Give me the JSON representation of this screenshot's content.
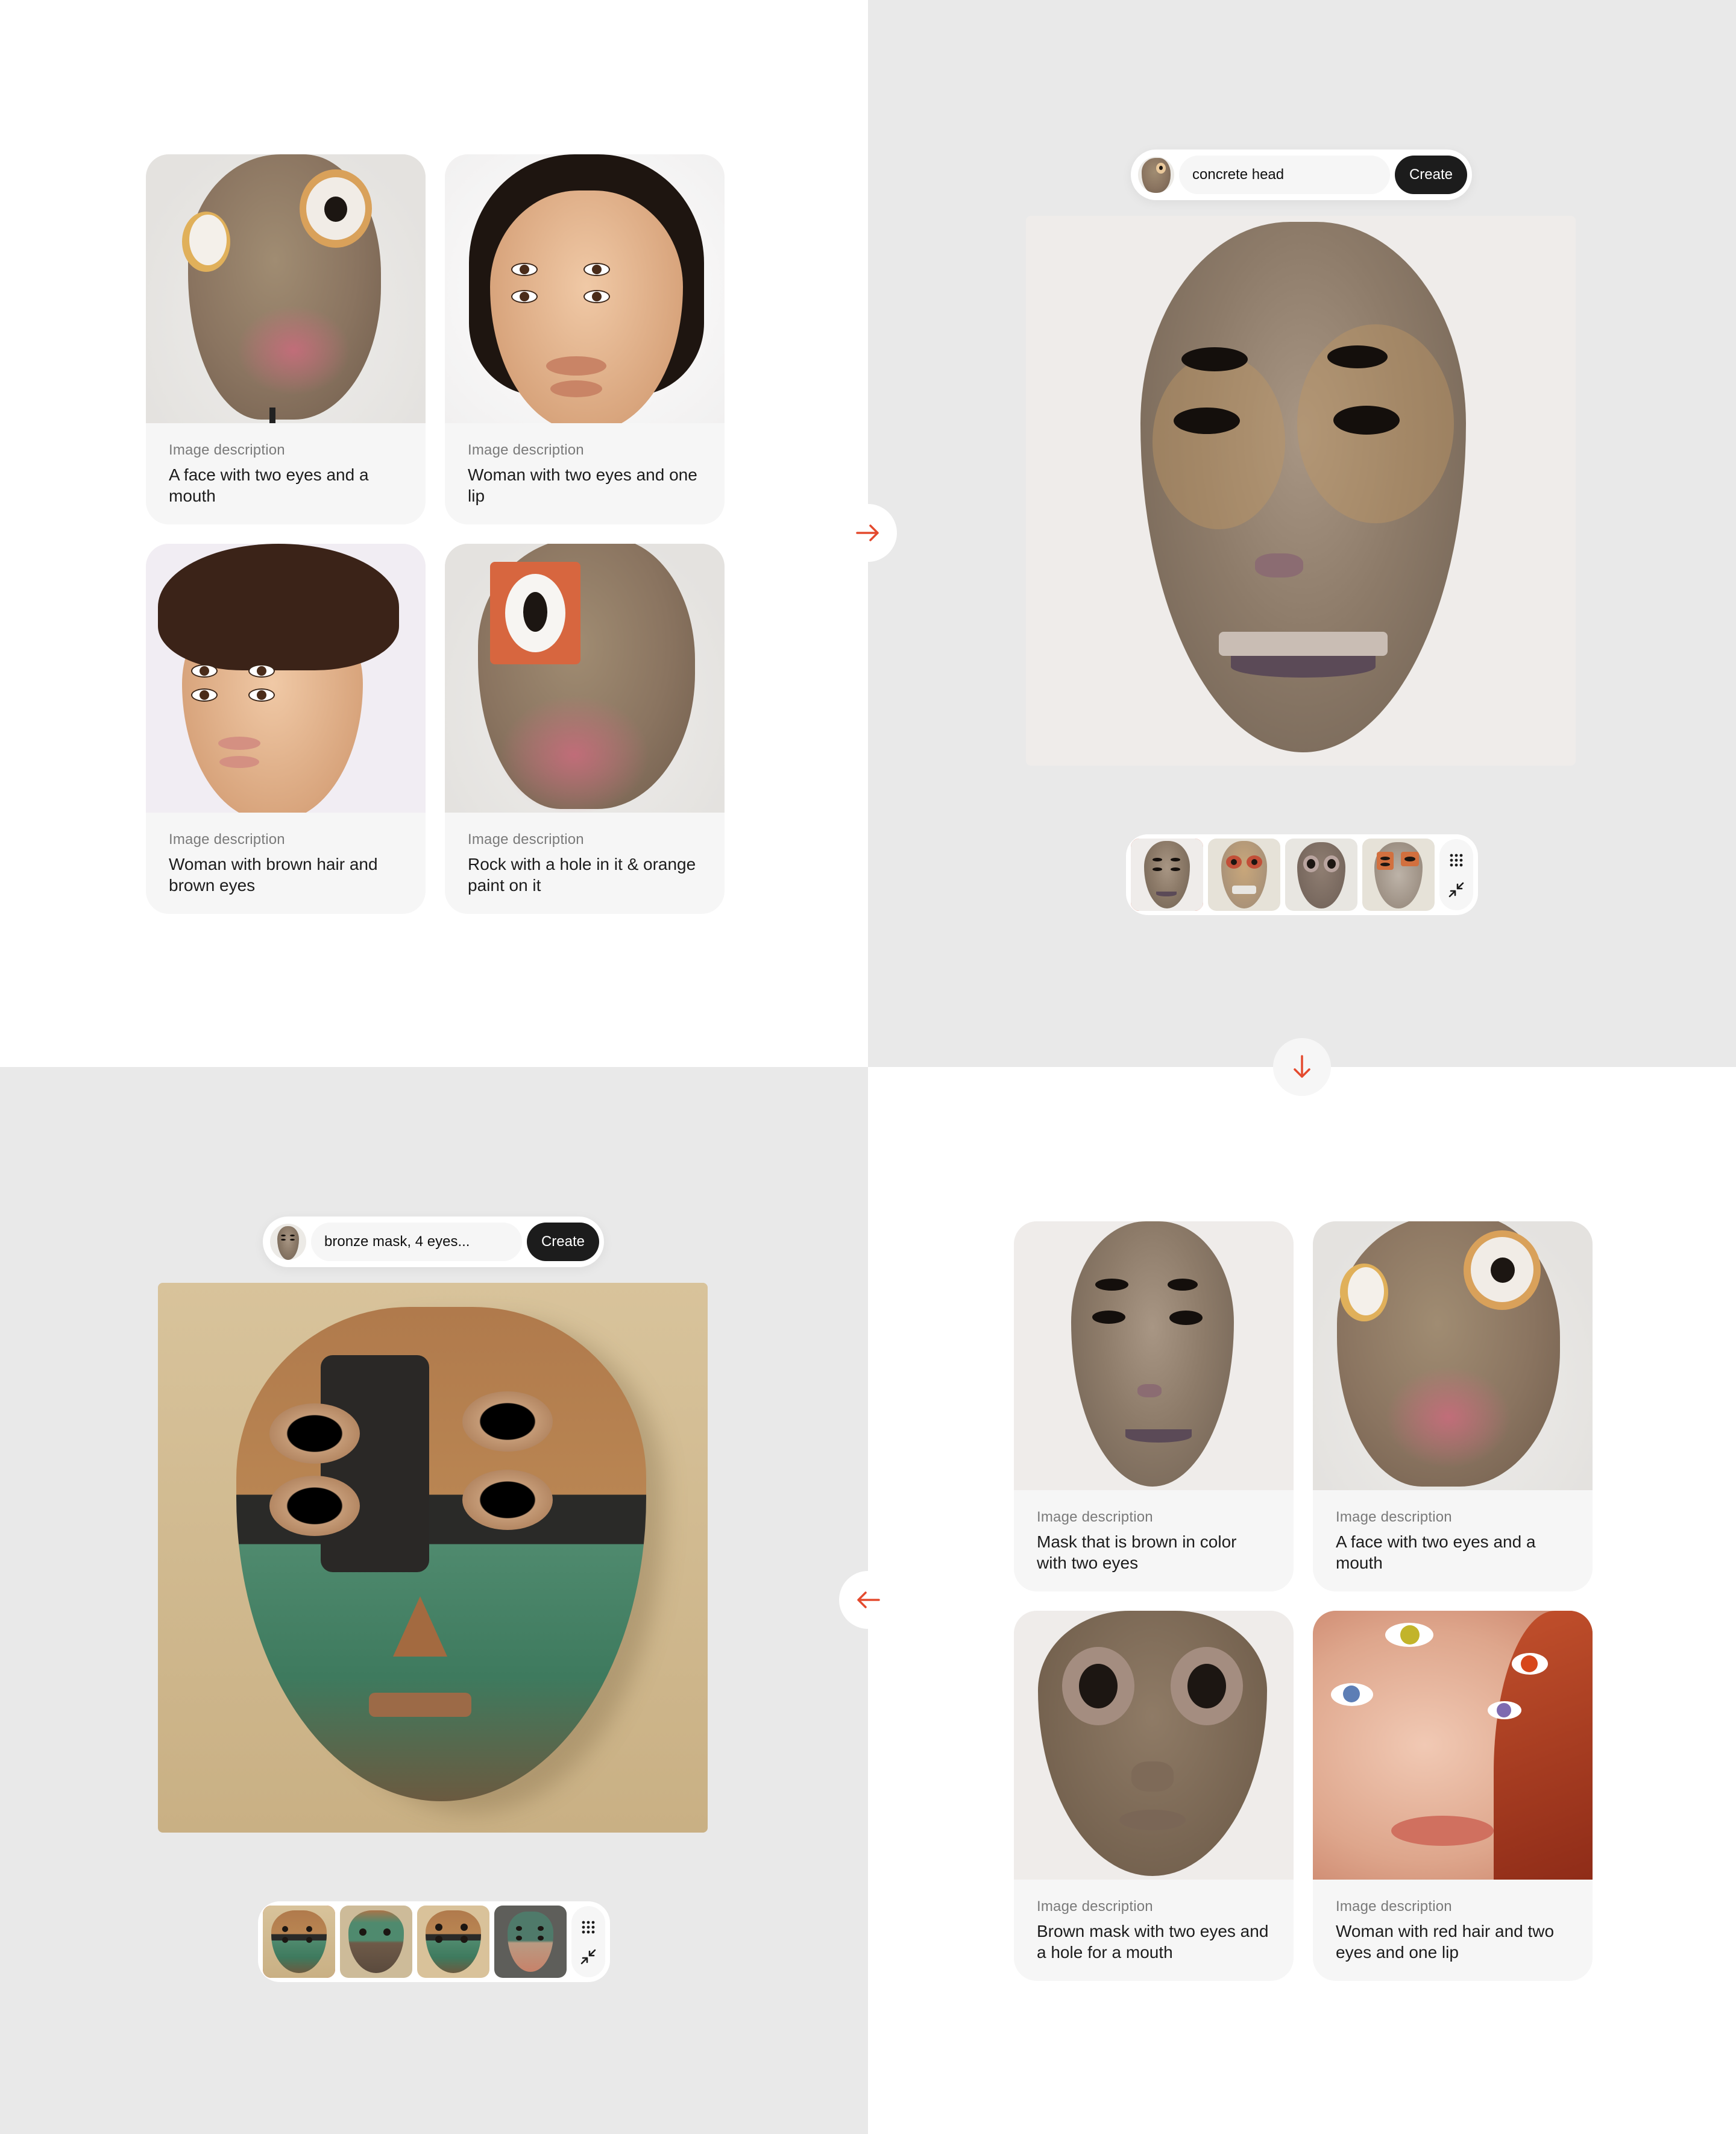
{
  "colors": {
    "accent": "#e44a2e",
    "panel_gray": "#e9e9e9",
    "card_bg": "#f6f6f6",
    "create_button": "#1c1c1c"
  },
  "step1": {
    "cards": [
      {
        "label": "Image description",
        "text": "A face with two eyes and a mouth",
        "image": "concrete-face-with-two-eyes"
      },
      {
        "label": "Image description",
        "text": "Woman with two eyes and one lip",
        "image": "woman-with-four-eyes"
      },
      {
        "label": "Image description",
        "text": "Woman with brown hair and brown eyes",
        "image": "woman-with-brown-hair-four-eyes"
      },
      {
        "label": "Image description",
        "text": "Rock with a hole in it & orange paint on it",
        "image": "rock-with-orange-eye"
      }
    ]
  },
  "arrows": {
    "right": "arrow-right-icon",
    "down": "arrow-down-icon",
    "left": "arrow-left-icon"
  },
  "step2": {
    "prompt": {
      "value": "concrete head",
      "create_label": "Create",
      "avatar": "concrete-face-thumbnail"
    },
    "preview_image": "concrete-mask-four-eyes",
    "variants": [
      {
        "image": "concrete-mask-variant-1",
        "selected": true
      },
      {
        "image": "concrete-mask-variant-2",
        "selected": false
      },
      {
        "image": "concrete-mask-variant-3",
        "selected": false
      },
      {
        "image": "concrete-mask-variant-4",
        "selected": false
      }
    ],
    "tools": [
      "grid-icon",
      "collapse-icon"
    ]
  },
  "step3": {
    "cards": [
      {
        "label": "Image description",
        "text": "Mask that is brown in color with two eyes",
        "image": "concrete-mask"
      },
      {
        "label": "Image description",
        "text": "A face with two eyes and a mouth",
        "image": "concrete-face-with-two-eyes"
      },
      {
        "label": "Image description",
        "text": "Brown mask with two eyes and a hole for a mouth",
        "image": "bronze-mask-two-eyes"
      },
      {
        "label": "Image description",
        "text": "Woman with red hair and two eyes and one lip",
        "image": "woman-with-red-hair"
      }
    ]
  },
  "step4": {
    "prompt": {
      "value": "bronze mask, 4 eyes...",
      "create_label": "Create",
      "avatar": "concrete-mask-thumbnail"
    },
    "preview_image": "bronze-mask-four-eyes",
    "variants": [
      {
        "image": "bronze-mask-variant-1",
        "selected": true
      },
      {
        "image": "bronze-mask-variant-2",
        "selected": false
      },
      {
        "image": "bronze-mask-variant-3",
        "selected": false
      },
      {
        "image": "bronze-mask-variant-4",
        "selected": false
      }
    ],
    "tools": [
      "grid-icon",
      "collapse-icon"
    ]
  }
}
